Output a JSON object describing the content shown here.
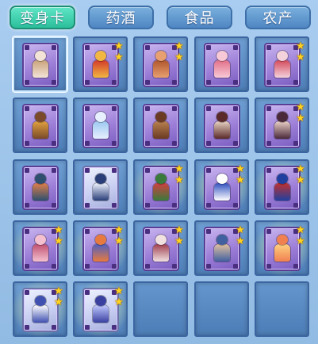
{
  "tabs": [
    {
      "label": "变身卡",
      "active": true
    },
    {
      "label": "药酒",
      "active": false
    },
    {
      "label": "食品",
      "active": false
    },
    {
      "label": "农产",
      "active": false
    }
  ],
  "inventory": {
    "rows": [
      [
        {
          "stars": 0,
          "glow": false,
          "selected": true,
          "card": "purple",
          "palette": [
            "#f3e3d6",
            "#c9a37a"
          ]
        },
        {
          "stars": 2,
          "glow": false,
          "selected": false,
          "card": "purple",
          "palette": [
            "#f2b642",
            "#d23a2a"
          ]
        },
        {
          "stars": 2,
          "glow": false,
          "selected": false,
          "card": "purple",
          "palette": [
            "#e8a070",
            "#b0562e"
          ]
        },
        {
          "stars": 0,
          "glow": false,
          "selected": false,
          "card": "purple",
          "palette": [
            "#f7c9d6",
            "#e2708a"
          ]
        },
        {
          "stars": 2,
          "glow": false,
          "selected": false,
          "card": "purple",
          "palette": [
            "#f4d2dc",
            "#d44a5c"
          ]
        }
      ],
      [
        {
          "stars": 0,
          "glow": false,
          "selected": false,
          "card": "purple",
          "palette": [
            "#7a4a2a",
            "#e0a040"
          ]
        },
        {
          "stars": 0,
          "glow": false,
          "selected": false,
          "card": "purple",
          "palette": [
            "#e7f0ff",
            "#9cc8f0"
          ]
        },
        {
          "stars": 0,
          "glow": false,
          "selected": false,
          "card": "purple",
          "palette": [
            "#6a3a22",
            "#b88050"
          ]
        },
        {
          "stars": 0,
          "glow": false,
          "selected": false,
          "card": "purple",
          "palette": [
            "#5a2a2a",
            "#e7d2c2"
          ]
        },
        {
          "stars": 2,
          "glow": false,
          "selected": false,
          "card": "purple",
          "palette": [
            "#4a2a3a",
            "#ead0c6"
          ]
        }
      ],
      [
        {
          "stars": 0,
          "glow": false,
          "selected": false,
          "card": "purple",
          "palette": [
            "#2e4f6e",
            "#e0804a"
          ]
        },
        {
          "stars": 0,
          "glow": false,
          "selected": false,
          "card": "silver",
          "palette": [
            "#2a3e78",
            "#f0f4ff"
          ]
        },
        {
          "stars": 2,
          "glow": true,
          "selected": false,
          "card": "purple",
          "palette": [
            "#3a7a3a",
            "#d04040"
          ]
        },
        {
          "stars": 2,
          "glow": true,
          "selected": false,
          "card": "purple",
          "palette": [
            "#ffffff",
            "#3050c0"
          ]
        },
        {
          "stars": 2,
          "glow": true,
          "selected": false,
          "card": "purple",
          "palette": [
            "#2040a0",
            "#c03030"
          ]
        }
      ],
      [
        {
          "stars": 2,
          "glow": true,
          "selected": false,
          "card": "purple",
          "palette": [
            "#f4c0d0",
            "#c05070"
          ]
        },
        {
          "stars": 2,
          "glow": true,
          "selected": false,
          "card": "purple",
          "palette": [
            "#e87a40",
            "#5060c0"
          ]
        },
        {
          "stars": 2,
          "glow": false,
          "selected": false,
          "card": "purple",
          "palette": [
            "#f0e0e0",
            "#a04050"
          ]
        },
        {
          "stars": 2,
          "glow": false,
          "selected": false,
          "card": "purple",
          "palette": [
            "#4060a0",
            "#e0c0a0"
          ]
        },
        {
          "stars": 2,
          "glow": true,
          "selected": false,
          "card": "purple",
          "palette": [
            "#f08050",
            "#ffd080"
          ]
        }
      ],
      [
        {
          "stars": 2,
          "glow": true,
          "selected": false,
          "card": "silver",
          "palette": [
            "#4050b0",
            "#ffffff"
          ]
        },
        {
          "stars": 2,
          "glow": true,
          "selected": false,
          "card": "silver",
          "palette": [
            "#3a40a0",
            "#c0c8ff"
          ]
        },
        null,
        null,
        null
      ]
    ]
  },
  "colors": {
    "tab_active": "#2bbf9b",
    "tab_inactive": "#4f86c2",
    "slot_bg": "#5d8ec8",
    "star": "#ffd21e",
    "background": "#9cc3e9"
  },
  "icons": {
    "star": "star-icon",
    "card": "transformation-card-icon"
  }
}
